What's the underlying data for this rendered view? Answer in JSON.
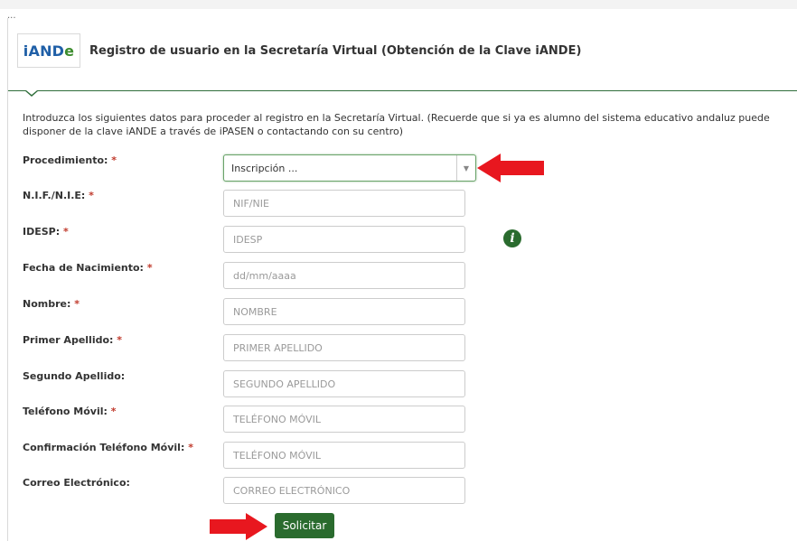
{
  "top": {
    "ellipsis": "..."
  },
  "header": {
    "logo": {
      "part1": "iAND",
      "part2": "e"
    },
    "title": "Registro de usuario en la Secretaría Virtual (Obtención de la Clave iANDE)"
  },
  "intro": "Introduzca los siguientes datos para proceder al registro en la Secretaría Virtual. (Recuerde que si ya es alumno del sistema educativo andaluz puede disponer de la clave iANDE a través de iPASEN o contactando con su centro)",
  "required_mark": "*",
  "form": {
    "procedimiento": {
      "label": "Procedimiento:",
      "value": "Inscripción ..."
    },
    "nif": {
      "label": "N.I.F./N.I.E:",
      "placeholder": "NIF/NIE"
    },
    "idesp": {
      "label": "IDESP:",
      "placeholder": "IDESP"
    },
    "fecha": {
      "label": "Fecha de Nacimiento:",
      "placeholder": "dd/mm/aaaa"
    },
    "nombre": {
      "label": "Nombre:",
      "placeholder": "NOMBRE"
    },
    "apellido1": {
      "label": "Primer Apellido:",
      "placeholder": "PRIMER APELLIDO"
    },
    "apellido2": {
      "label": "Segundo Apellido:",
      "placeholder": "SEGUNDO APELLIDO"
    },
    "telefono": {
      "label": "Teléfono Móvil:",
      "placeholder": "TELÉFONO MÓVIL"
    },
    "telefono_conf": {
      "label": "Confirmación Teléfono Móvil:",
      "placeholder": "TELÉFONO MÓVIL"
    },
    "correo": {
      "label": "Correo Electrónico:",
      "placeholder": "CORREO ELECTRÓNICO"
    }
  },
  "submit_label": "Solicitar",
  "colors": {
    "brand_green": "#2a6b2e",
    "arrow_red": "#e8171f",
    "required_red": "#c0392b",
    "logo_blue": "#1f5fa7"
  },
  "icons": {
    "info": "info-icon",
    "dropdown": "chevron-down-icon",
    "arrow": "red-arrow-icon"
  }
}
